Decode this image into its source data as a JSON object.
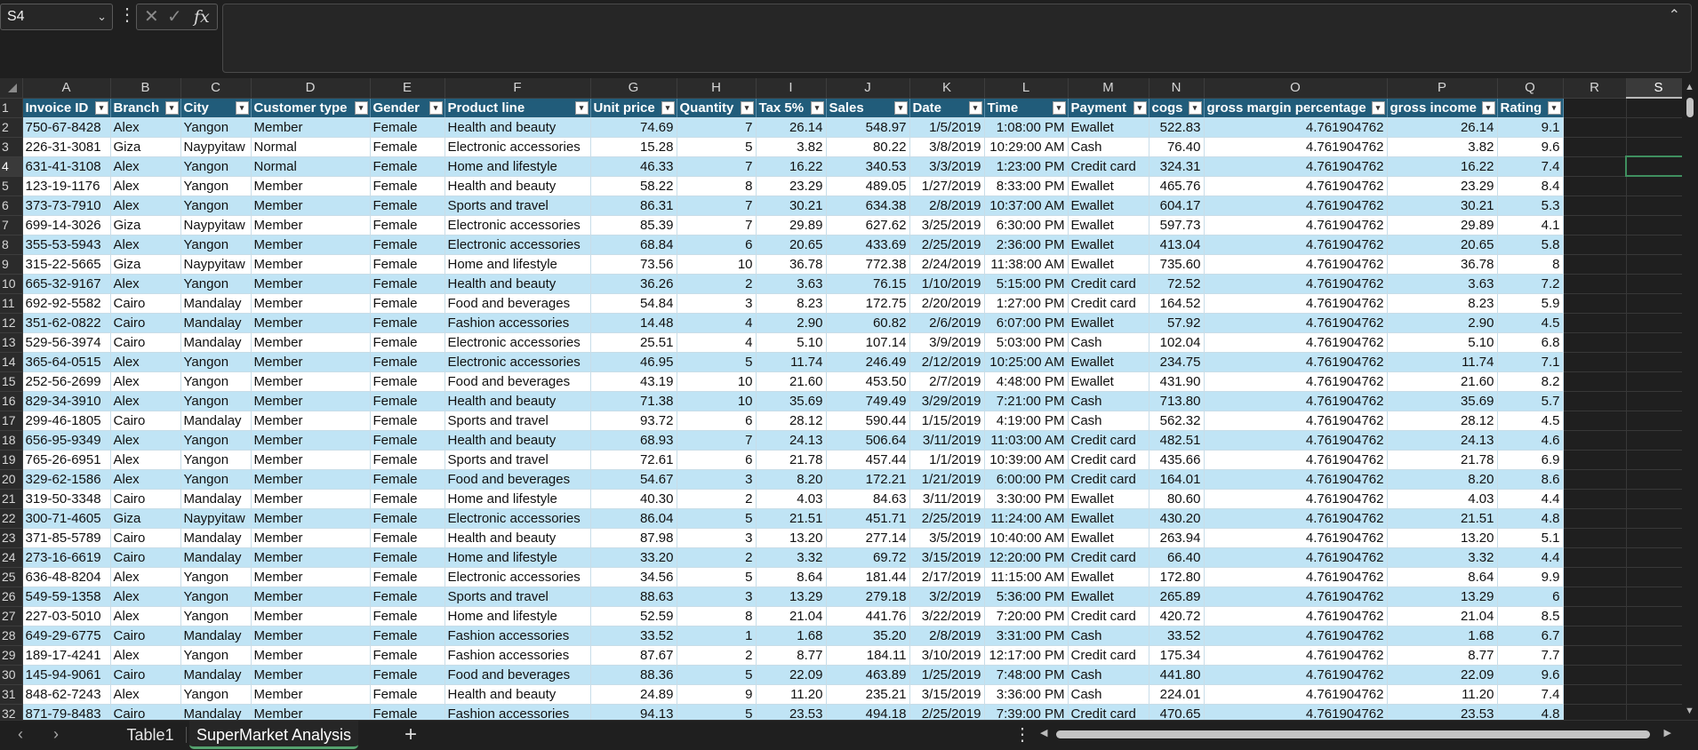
{
  "formula_bar": {
    "name_box": "S4",
    "name_box_chevron": "chevron-down-icon",
    "fx_label": "fx",
    "formula": ""
  },
  "grid": {
    "column_letters": [
      "A",
      "B",
      "C",
      "D",
      "E",
      "F",
      "G",
      "H",
      "I",
      "J",
      "K",
      "L",
      "M",
      "N",
      "O",
      "P",
      "Q",
      "R",
      "S"
    ],
    "selected_column": "S",
    "selected_row": 4,
    "header_row_number": 1,
    "table_headers": [
      "Invoice ID",
      "Branch",
      "City",
      "Customer type",
      "Gender",
      "Product line",
      "Unit price",
      "Quantity",
      "Tax 5%",
      "Sales",
      "Date",
      "Time",
      "Payment",
      "cogs",
      "gross margin percentage",
      "gross income",
      "Rating"
    ],
    "rows": [
      {
        "n": 2,
        "cells": [
          "750-67-8428",
          "Alex",
          "Yangon",
          "Member",
          "Female",
          "Health and beauty",
          "74.69",
          "7",
          "26.14",
          "548.97",
          "1/5/2019",
          "1:08:00 PM",
          "Ewallet",
          "522.83",
          "4.761904762",
          "26.14",
          "9.1"
        ]
      },
      {
        "n": 3,
        "cells": [
          "226-31-3081",
          "Giza",
          "Naypyitaw",
          "Normal",
          "Female",
          "Electronic accessories",
          "15.28",
          "5",
          "3.82",
          "80.22",
          "3/8/2019",
          "10:29:00 AM",
          "Cash",
          "76.40",
          "4.761904762",
          "3.82",
          "9.6"
        ]
      },
      {
        "n": 4,
        "cells": [
          "631-41-3108",
          "Alex",
          "Yangon",
          "Normal",
          "Female",
          "Home and lifestyle",
          "46.33",
          "7",
          "16.22",
          "340.53",
          "3/3/2019",
          "1:23:00 PM",
          "Credit card",
          "324.31",
          "4.761904762",
          "16.22",
          "7.4"
        ]
      },
      {
        "n": 5,
        "cells": [
          "123-19-1176",
          "Alex",
          "Yangon",
          "Member",
          "Female",
          "Health and beauty",
          "58.22",
          "8",
          "23.29",
          "489.05",
          "1/27/2019",
          "8:33:00 PM",
          "Ewallet",
          "465.76",
          "4.761904762",
          "23.29",
          "8.4"
        ]
      },
      {
        "n": 6,
        "cells": [
          "373-73-7910",
          "Alex",
          "Yangon",
          "Member",
          "Female",
          "Sports and travel",
          "86.31",
          "7",
          "30.21",
          "634.38",
          "2/8/2019",
          "10:37:00 AM",
          "Ewallet",
          "604.17",
          "4.761904762",
          "30.21",
          "5.3"
        ]
      },
      {
        "n": 7,
        "cells": [
          "699-14-3026",
          "Giza",
          "Naypyitaw",
          "Member",
          "Female",
          "Electronic accessories",
          "85.39",
          "7",
          "29.89",
          "627.62",
          "3/25/2019",
          "6:30:00 PM",
          "Ewallet",
          "597.73",
          "4.761904762",
          "29.89",
          "4.1"
        ]
      },
      {
        "n": 8,
        "cells": [
          "355-53-5943",
          "Alex",
          "Yangon",
          "Member",
          "Female",
          "Electronic accessories",
          "68.84",
          "6",
          "20.65",
          "433.69",
          "2/25/2019",
          "2:36:00 PM",
          "Ewallet",
          "413.04",
          "4.761904762",
          "20.65",
          "5.8"
        ]
      },
      {
        "n": 9,
        "cells": [
          "315-22-5665",
          "Giza",
          "Naypyitaw",
          "Member",
          "Female",
          "Home and lifestyle",
          "73.56",
          "10",
          "36.78",
          "772.38",
          "2/24/2019",
          "11:38:00 AM",
          "Ewallet",
          "735.60",
          "4.761904762",
          "36.78",
          "8"
        ]
      },
      {
        "n": 10,
        "cells": [
          "665-32-9167",
          "Alex",
          "Yangon",
          "Member",
          "Female",
          "Health and beauty",
          "36.26",
          "2",
          "3.63",
          "76.15",
          "1/10/2019",
          "5:15:00 PM",
          "Credit card",
          "72.52",
          "4.761904762",
          "3.63",
          "7.2"
        ]
      },
      {
        "n": 11,
        "cells": [
          "692-92-5582",
          "Cairo",
          "Mandalay",
          "Member",
          "Female",
          "Food and beverages",
          "54.84",
          "3",
          "8.23",
          "172.75",
          "2/20/2019",
          "1:27:00 PM",
          "Credit card",
          "164.52",
          "4.761904762",
          "8.23",
          "5.9"
        ]
      },
      {
        "n": 12,
        "cells": [
          "351-62-0822",
          "Cairo",
          "Mandalay",
          "Member",
          "Female",
          "Fashion accessories",
          "14.48",
          "4",
          "2.90",
          "60.82",
          "2/6/2019",
          "6:07:00 PM",
          "Ewallet",
          "57.92",
          "4.761904762",
          "2.90",
          "4.5"
        ]
      },
      {
        "n": 13,
        "cells": [
          "529-56-3974",
          "Cairo",
          "Mandalay",
          "Member",
          "Female",
          "Electronic accessories",
          "25.51",
          "4",
          "5.10",
          "107.14",
          "3/9/2019",
          "5:03:00 PM",
          "Cash",
          "102.04",
          "4.761904762",
          "5.10",
          "6.8"
        ]
      },
      {
        "n": 14,
        "cells": [
          "365-64-0515",
          "Alex",
          "Yangon",
          "Member",
          "Female",
          "Electronic accessories",
          "46.95",
          "5",
          "11.74",
          "246.49",
          "2/12/2019",
          "10:25:00 AM",
          "Ewallet",
          "234.75",
          "4.761904762",
          "11.74",
          "7.1"
        ]
      },
      {
        "n": 15,
        "cells": [
          "252-56-2699",
          "Alex",
          "Yangon",
          "Member",
          "Female",
          "Food and beverages",
          "43.19",
          "10",
          "21.60",
          "453.50",
          "2/7/2019",
          "4:48:00 PM",
          "Ewallet",
          "431.90",
          "4.761904762",
          "21.60",
          "8.2"
        ]
      },
      {
        "n": 16,
        "cells": [
          "829-34-3910",
          "Alex",
          "Yangon",
          "Member",
          "Female",
          "Health and beauty",
          "71.38",
          "10",
          "35.69",
          "749.49",
          "3/29/2019",
          "7:21:00 PM",
          "Cash",
          "713.80",
          "4.761904762",
          "35.69",
          "5.7"
        ]
      },
      {
        "n": 17,
        "cells": [
          "299-46-1805",
          "Cairo",
          "Mandalay",
          "Member",
          "Female",
          "Sports and travel",
          "93.72",
          "6",
          "28.12",
          "590.44",
          "1/15/2019",
          "4:19:00 PM",
          "Cash",
          "562.32",
          "4.761904762",
          "28.12",
          "4.5"
        ]
      },
      {
        "n": 18,
        "cells": [
          "656-95-9349",
          "Alex",
          "Yangon",
          "Member",
          "Female",
          "Health and beauty",
          "68.93",
          "7",
          "24.13",
          "506.64",
          "3/11/2019",
          "11:03:00 AM",
          "Credit card",
          "482.51",
          "4.761904762",
          "24.13",
          "4.6"
        ]
      },
      {
        "n": 19,
        "cells": [
          "765-26-6951",
          "Alex",
          "Yangon",
          "Member",
          "Female",
          "Sports and travel",
          "72.61",
          "6",
          "21.78",
          "457.44",
          "1/1/2019",
          "10:39:00 AM",
          "Credit card",
          "435.66",
          "4.761904762",
          "21.78",
          "6.9"
        ]
      },
      {
        "n": 20,
        "cells": [
          "329-62-1586",
          "Alex",
          "Yangon",
          "Member",
          "Female",
          "Food and beverages",
          "54.67",
          "3",
          "8.20",
          "172.21",
          "1/21/2019",
          "6:00:00 PM",
          "Credit card",
          "164.01",
          "4.761904762",
          "8.20",
          "8.6"
        ]
      },
      {
        "n": 21,
        "cells": [
          "319-50-3348",
          "Cairo",
          "Mandalay",
          "Member",
          "Female",
          "Home and lifestyle",
          "40.30",
          "2",
          "4.03",
          "84.63",
          "3/11/2019",
          "3:30:00 PM",
          "Ewallet",
          "80.60",
          "4.761904762",
          "4.03",
          "4.4"
        ]
      },
      {
        "n": 22,
        "cells": [
          "300-71-4605",
          "Giza",
          "Naypyitaw",
          "Member",
          "Female",
          "Electronic accessories",
          "86.04",
          "5",
          "21.51",
          "451.71",
          "2/25/2019",
          "11:24:00 AM",
          "Ewallet",
          "430.20",
          "4.761904762",
          "21.51",
          "4.8"
        ]
      },
      {
        "n": 23,
        "cells": [
          "371-85-5789",
          "Cairo",
          "Mandalay",
          "Member",
          "Female",
          "Health and beauty",
          "87.98",
          "3",
          "13.20",
          "277.14",
          "3/5/2019",
          "10:40:00 AM",
          "Ewallet",
          "263.94",
          "4.761904762",
          "13.20",
          "5.1"
        ]
      },
      {
        "n": 24,
        "cells": [
          "273-16-6619",
          "Cairo",
          "Mandalay",
          "Member",
          "Female",
          "Home and lifestyle",
          "33.20",
          "2",
          "3.32",
          "69.72",
          "3/15/2019",
          "12:20:00 PM",
          "Credit card",
          "66.40",
          "4.761904762",
          "3.32",
          "4.4"
        ]
      },
      {
        "n": 25,
        "cells": [
          "636-48-8204",
          "Alex",
          "Yangon",
          "Member",
          "Female",
          "Electronic accessories",
          "34.56",
          "5",
          "8.64",
          "181.44",
          "2/17/2019",
          "11:15:00 AM",
          "Ewallet",
          "172.80",
          "4.761904762",
          "8.64",
          "9.9"
        ]
      },
      {
        "n": 26,
        "cells": [
          "549-59-1358",
          "Alex",
          "Yangon",
          "Member",
          "Female",
          "Sports and travel",
          "88.63",
          "3",
          "13.29",
          "279.18",
          "3/2/2019",
          "5:36:00 PM",
          "Ewallet",
          "265.89",
          "4.761904762",
          "13.29",
          "6"
        ]
      },
      {
        "n": 27,
        "cells": [
          "227-03-5010",
          "Alex",
          "Yangon",
          "Member",
          "Female",
          "Home and lifestyle",
          "52.59",
          "8",
          "21.04",
          "441.76",
          "3/22/2019",
          "7:20:00 PM",
          "Credit card",
          "420.72",
          "4.761904762",
          "21.04",
          "8.5"
        ]
      },
      {
        "n": 28,
        "cells": [
          "649-29-6775",
          "Cairo",
          "Mandalay",
          "Member",
          "Female",
          "Fashion accessories",
          "33.52",
          "1",
          "1.68",
          "35.20",
          "2/8/2019",
          "3:31:00 PM",
          "Cash",
          "33.52",
          "4.761904762",
          "1.68",
          "6.7"
        ]
      },
      {
        "n": 29,
        "cells": [
          "189-17-4241",
          "Alex",
          "Yangon",
          "Member",
          "Female",
          "Fashion accessories",
          "87.67",
          "2",
          "8.77",
          "184.11",
          "3/10/2019",
          "12:17:00 PM",
          "Credit card",
          "175.34",
          "4.761904762",
          "8.77",
          "7.7"
        ]
      },
      {
        "n": 30,
        "cells": [
          "145-94-9061",
          "Cairo",
          "Mandalay",
          "Member",
          "Female",
          "Food and beverages",
          "88.36",
          "5",
          "22.09",
          "463.89",
          "1/25/2019",
          "7:48:00 PM",
          "Cash",
          "441.80",
          "4.761904762",
          "22.09",
          "9.6"
        ]
      },
      {
        "n": 31,
        "cells": [
          "848-62-7243",
          "Alex",
          "Yangon",
          "Member",
          "Female",
          "Health and beauty",
          "24.89",
          "9",
          "11.20",
          "235.21",
          "3/15/2019",
          "3:36:00 PM",
          "Cash",
          "224.01",
          "4.761904762",
          "11.20",
          "7.4"
        ]
      },
      {
        "n": 32,
        "cells": [
          "871-79-8483",
          "Cairo",
          "Mandalay",
          "Member",
          "Female",
          "Fashion accessories",
          "94.13",
          "5",
          "23.53",
          "494.18",
          "2/25/2019",
          "7:39:00 PM",
          "Credit card",
          "470.65",
          "4.761904762",
          "23.53",
          "4.8"
        ]
      }
    ]
  },
  "sheet_tabs": {
    "tabs": [
      "Table1",
      "SuperMarket Analysis"
    ],
    "active": "SuperMarket Analysis",
    "add_label": "+"
  },
  "colors": {
    "header_fill": "#215c7a",
    "band_fill": "#c0e4f5",
    "active_tab_underline": "#55a36f"
  }
}
